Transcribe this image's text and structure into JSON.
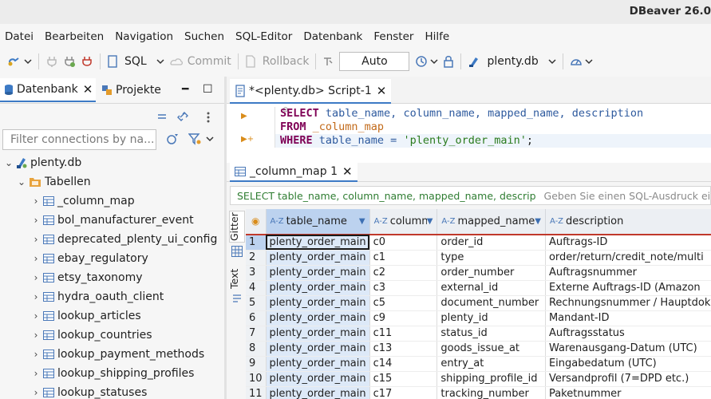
{
  "window": {
    "title": "DBeaver 26.0"
  },
  "menu": [
    "Datei",
    "Bearbeiten",
    "Navigation",
    "Suchen",
    "SQL-Editor",
    "Datenbank",
    "Fenster",
    "Hilfe"
  ],
  "toolbar": {
    "sql_label": "SQL",
    "commit_label": "Commit",
    "rollback_label": "Rollback",
    "transaction_mode": "Auto",
    "datasource": "plenty.db"
  },
  "left_panel": {
    "tab_database": "Datenbank",
    "tab_projects": "Projekte",
    "filter_placeholder": "Filter connections by na...",
    "connection": "plenty.db",
    "folder": "Tabellen",
    "tables": [
      "_column_map",
      "bol_manufacturer_event",
      "deprecated_plenty_ui_config",
      "ebay_regulatory",
      "etsy_taxonomy",
      "hydra_oauth_client",
      "lookup_articles",
      "lookup_countries",
      "lookup_payment_methods",
      "lookup_shipping_profiles",
      "lookup_statuses"
    ]
  },
  "editor": {
    "tab_label": "*<plenty.db> Script-1",
    "code": {
      "l1_kw": "SELECT",
      "l1_cols": " table_name, column_name, mapped_name, description",
      "l2_kw": "FROM",
      "l2_table": " _column_map",
      "l3_kw": "WHERE",
      "l3_col": " table_name = ",
      "l3_str": "'plenty_order_main'",
      "l3_end": ";"
    }
  },
  "results": {
    "tab_label": "_column_map 1",
    "query_preview": "SELECT table_name, column_name, mapped_name, descrip",
    "filter_hint": "Geben Sie einen SQL-Ausdruck ein, um",
    "side_grid_label": "Gitter",
    "side_text_label": "Text",
    "columns": [
      "table_name",
      "column_name",
      "mapped_name",
      "description"
    ],
    "rows": [
      [
        "1",
        "plenty_order_main",
        "c0",
        "order_id",
        "Auftrags-ID"
      ],
      [
        "2",
        "plenty_order_main",
        "c1",
        "type",
        "order/return/credit_note/multi"
      ],
      [
        "3",
        "plenty_order_main",
        "c2",
        "order_number",
        "Auftragsnummer"
      ],
      [
        "4",
        "plenty_order_main",
        "c3",
        "external_id",
        "Externe Auftrags-ID (Amazon"
      ],
      [
        "5",
        "plenty_order_main",
        "c5",
        "document_number",
        "Rechnungsnummer / Hauptdok"
      ],
      [
        "6",
        "plenty_order_main",
        "c9",
        "plenty_id",
        "Mandant-ID"
      ],
      [
        "7",
        "plenty_order_main",
        "c11",
        "status_id",
        "Auftragsstatus"
      ],
      [
        "8",
        "plenty_order_main",
        "c13",
        "goods_issue_at",
        "Warenausgang-Datum (UTC)"
      ],
      [
        "9",
        "plenty_order_main",
        "c14",
        "entry_at",
        "Eingabedatum (UTC)"
      ],
      [
        "10",
        "plenty_order_main",
        "c15",
        "shipping_profile_id",
        "Versandprofil (7=DPD etc.)"
      ],
      [
        "11",
        "plenty_order_main",
        "c17",
        "tracking_number",
        "Paketnummer"
      ]
    ]
  }
}
